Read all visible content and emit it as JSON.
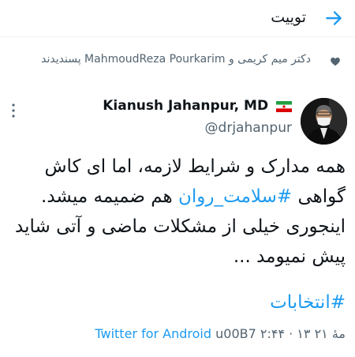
{
  "header": {
    "title": "توییت"
  },
  "liked_by": {
    "text": "دکتر میم کریمی و MahmoudReza Pourkarim پسندیدند"
  },
  "tweet": {
    "author_name": "Kianush Jahanpur, MD",
    "handle": "@drjahanpur",
    "body_part1": "همه مدارک و شرایط لازمه، اما ای کاش گواهی ",
    "hashtag1": "#سلامت_روان",
    "body_part2": " هم ضمیمه میشد. اینجوری خیلی از مشکلات ماضی و آتی شاید پیش نمیومد ...",
    "hashtag2": "#انتخابات",
    "timestamp": "۲:۴۴ · ۱۳ مهٔ ۲۱",
    "separator": "u00B7",
    "source": "Twitter for Android"
  },
  "colors": {
    "accent": "#1d9bf0",
    "text": "#0f1419",
    "secondary": "#536471"
  }
}
